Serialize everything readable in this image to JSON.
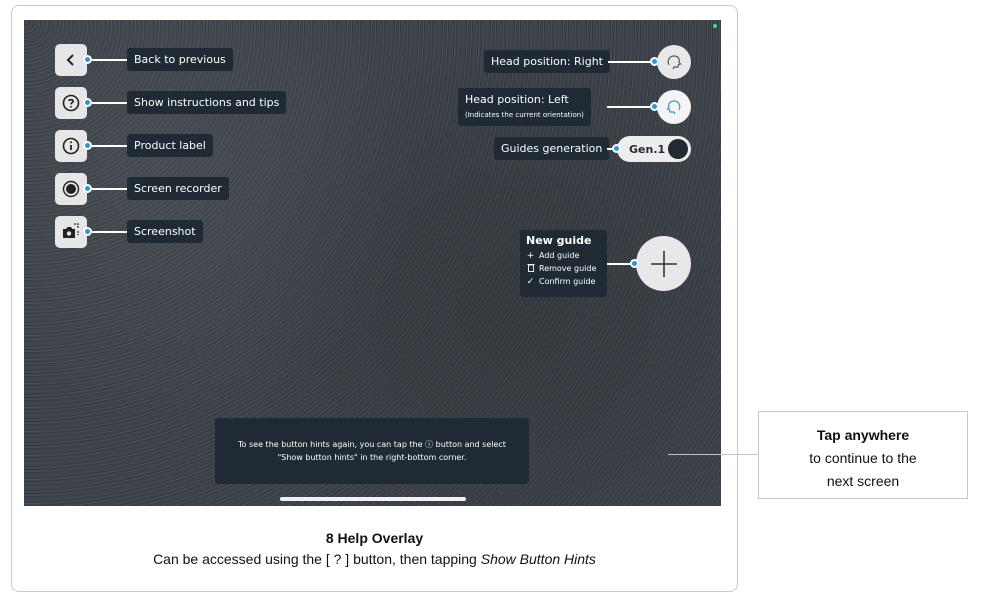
{
  "left_controls": [
    {
      "name": "back",
      "icon": "chevron-left-icon",
      "hint": "Back to previous"
    },
    {
      "name": "instructions",
      "icon": "question-circle-icon",
      "hint": "Show instructions and tips"
    },
    {
      "name": "product-label",
      "icon": "info-circle-icon",
      "hint": "Product label"
    },
    {
      "name": "screen-recorder",
      "icon": "record-icon",
      "hint": "Screen recorder"
    },
    {
      "name": "screenshot",
      "icon": "camera-icon",
      "hint": "Screenshot"
    }
  ],
  "right_controls": {
    "head_right": {
      "hint": "Head position: Right",
      "icon": "head-right-icon"
    },
    "head_left": {
      "hint": "Head position: Left",
      "subhint": "(Indicates the current orientation)",
      "icon": "head-left-icon"
    },
    "guides_generation": {
      "hint": "Guides generation",
      "toggle_label": "Gen.1"
    },
    "new_guide": {
      "title": "New guide",
      "items": [
        {
          "icon": "plus-icon",
          "label": "Add guide"
        },
        {
          "icon": "trash-icon",
          "label": "Remove guide"
        },
        {
          "icon": "check-icon",
          "label": "Confirm guide"
        }
      ],
      "button_icon": "plus-icon"
    }
  },
  "bottom_message": {
    "line1": "To see the button hints again, you can tap the ⓘ button and select",
    "line2": "\"Show button hints\" in the right-bottom corner."
  },
  "caption": {
    "title": "8 Help Overlay",
    "subtitle_prefix": "Can be accessed using the [ ? ] button, then tapping ",
    "subtitle_emph": "Show Button Hints"
  },
  "tap_note": {
    "bold": "Tap anywhere",
    "line2": "to continue to the",
    "line3": "next screen"
  },
  "colors": {
    "hint_bg": "#1f2a33",
    "dot_blue": "#2b97d6",
    "button_bg": "#e6e6e6"
  }
}
